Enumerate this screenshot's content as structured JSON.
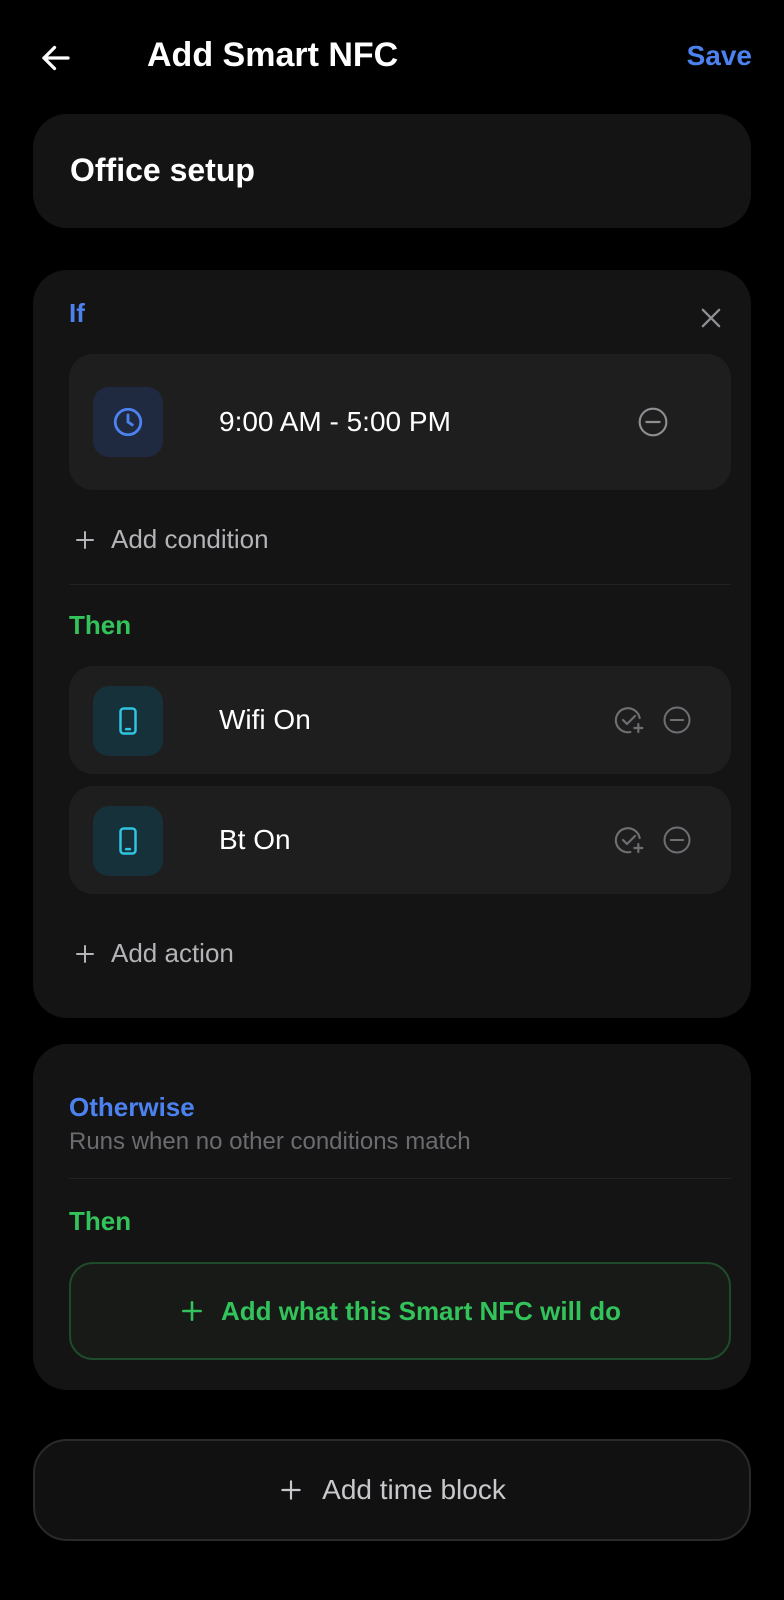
{
  "header": {
    "title": "Add Smart NFC",
    "save_label": "Save"
  },
  "name_card": {
    "value": "Office setup"
  },
  "if_section": {
    "label": "If",
    "condition": {
      "icon": "clock-icon",
      "text": "9:00 AM - 5:00 PM"
    },
    "add_condition_label": "Add condition",
    "then_label": "Then",
    "actions": [
      {
        "icon": "phone-icon",
        "text": "Wifi On"
      },
      {
        "icon": "phone-icon",
        "text": "Bt On"
      }
    ],
    "add_action_label": "Add action"
  },
  "otherwise_section": {
    "label": "Otherwise",
    "description": "Runs when no other conditions match",
    "then_label": "Then",
    "add_button_label": "Add what this Smart NFC will do"
  },
  "add_time_block_label": "Add time block",
  "colors": {
    "accent_blue": "#4c82f0",
    "accent_green": "#32c35a",
    "cyan_icon": "#2fc4e0",
    "background": "#000000",
    "card": "#141414"
  }
}
